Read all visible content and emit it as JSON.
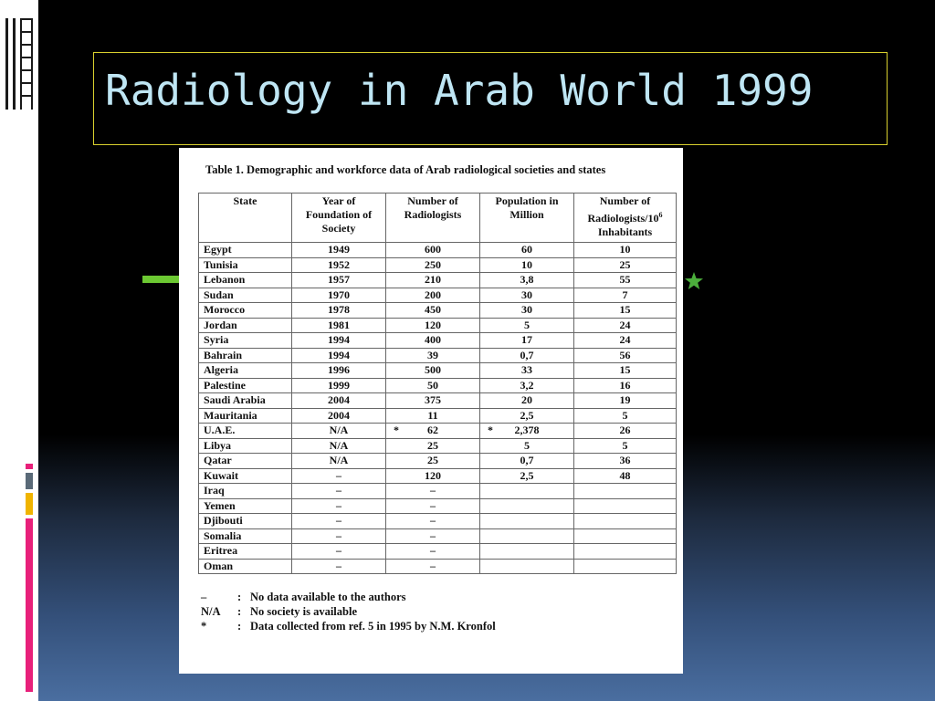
{
  "slide": {
    "title": "Radiology in Arab World 1999"
  },
  "table": {
    "caption": "Table 1.  Demographic and workforce data of Arab radiological societies and states",
    "headers": {
      "state": "State",
      "year": "Year of Foundation of Society",
      "radiologists": "Number of Radiologists",
      "population": "Population in Million",
      "per_million": "Number of Radiologists/10",
      "per_million_sup": "6",
      "per_million_tail": "Inhabitants"
    },
    "rows": [
      {
        "state": "Egypt",
        "year": "1949",
        "radiologists": "600",
        "population": "60",
        "per_million": "10"
      },
      {
        "state": "Tunisia",
        "year": "1952",
        "radiologists": "250",
        "population": "10",
        "per_million": "25"
      },
      {
        "state": "Lebanon",
        "year": "1957",
        "radiologists": "210",
        "population": "3,8",
        "per_million": "55"
      },
      {
        "state": "Sudan",
        "year": "1970",
        "radiologists": "200",
        "population": "30",
        "per_million": "7"
      },
      {
        "state": "Morocco",
        "year": "1978",
        "radiologists": "450",
        "population": "30",
        "per_million": "15"
      },
      {
        "state": "Jordan",
        "year": "1981",
        "radiologists": "120",
        "population": "5",
        "per_million": "24"
      },
      {
        "state": "Syria",
        "year": "1994",
        "radiologists": "400",
        "population": "17",
        "per_million": "24"
      },
      {
        "state": "Bahrain",
        "year": "1994",
        "radiologists": "39",
        "population": "0,7",
        "per_million": "56"
      },
      {
        "state": "Algeria",
        "year": "1996",
        "radiologists": "500",
        "population": "33",
        "per_million": "15"
      },
      {
        "state": "Palestine",
        "year": "1999",
        "radiologists": "50",
        "population": "3,2",
        "per_million": "16"
      },
      {
        "state": "Saudi Arabia",
        "year": "2004",
        "radiologists": "375",
        "population": "20",
        "per_million": "19"
      },
      {
        "state": "Mauritania",
        "year": "2004",
        "radiologists": "11",
        "population": "2,5",
        "per_million": "5"
      },
      {
        "state": "U.A.E.",
        "year": "N/A",
        "radiologists": "62",
        "population": "2,378",
        "per_million": "26",
        "rad_mark": "*",
        "pop_mark": "*"
      },
      {
        "state": "Libya",
        "year": "N/A",
        "radiologists": "25",
        "population": "5",
        "per_million": "5"
      },
      {
        "state": "Qatar",
        "year": "N/A",
        "radiologists": "25",
        "population": "0,7",
        "per_million": "36"
      },
      {
        "state": "Kuwait",
        "year": "–",
        "radiologists": "120",
        "population": "2,5",
        "per_million": "48"
      },
      {
        "state": "Iraq",
        "year": "–",
        "radiologists": "–",
        "population": "",
        "per_million": ""
      },
      {
        "state": "Yemen",
        "year": "–",
        "radiologists": "–",
        "population": "",
        "per_million": ""
      },
      {
        "state": "Djibouti",
        "year": "–",
        "radiologists": "–",
        "population": "",
        "per_million": ""
      },
      {
        "state": "Somalia",
        "year": "–",
        "radiologists": "–",
        "population": "",
        "per_million": ""
      },
      {
        "state": "Eritrea",
        "year": "–",
        "radiologists": "–",
        "population": "",
        "per_million": ""
      },
      {
        "state": "Oman",
        "year": "–",
        "radiologists": "–",
        "population": "",
        "per_million": ""
      }
    ],
    "legend": [
      {
        "key": "–",
        "text": "No data available to the authors"
      },
      {
        "key": "N/A",
        "text": "No society is available"
      },
      {
        "key": "*",
        "text": "Data collected from ref. 5 in 1995 by N.M. Kronfol"
      }
    ],
    "legend_sep": ":"
  },
  "annotations": {
    "arrow_color": "#6cc832",
    "star_color": "#4caf3c",
    "highlighted_row": "Lebanon"
  },
  "theme": {
    "title_color": "#bfe6f4",
    "title_border": "#d8cf2e",
    "accent_colors": [
      "#e8207a",
      "#5a6a78",
      "#f0b400",
      "#e8207a"
    ]
  }
}
